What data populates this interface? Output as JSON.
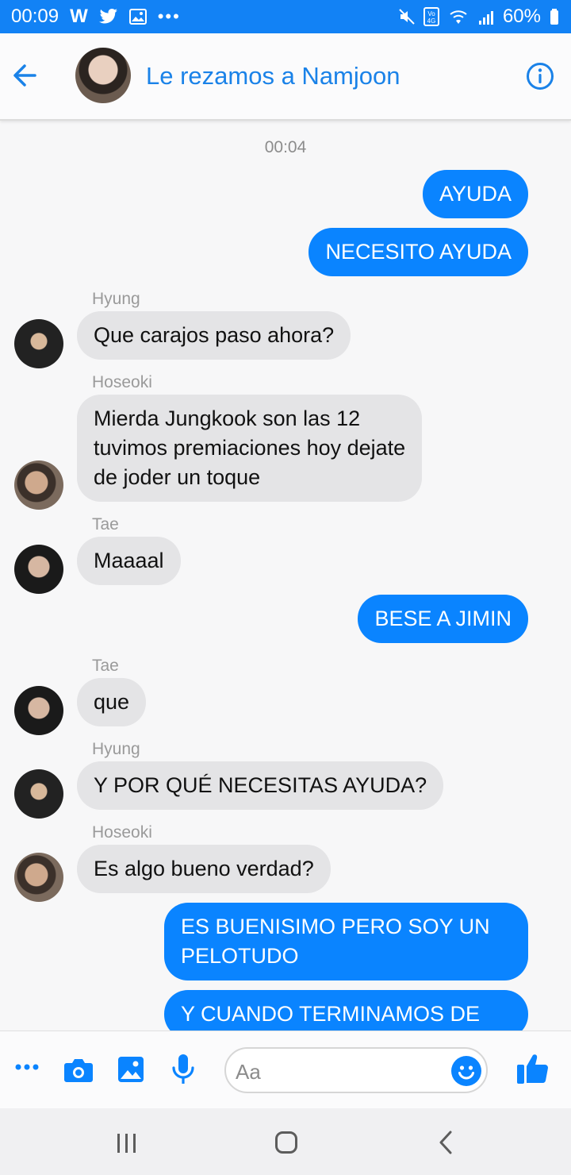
{
  "status_bar": {
    "time": "00:09",
    "battery": "60%"
  },
  "header": {
    "title": "Le rezamos a Namjoon"
  },
  "chat": {
    "timestamp": "00:04",
    "messages": [
      {
        "id": "m1",
        "type": "out",
        "text": "AYUDA"
      },
      {
        "id": "m2",
        "type": "out",
        "text": "NECESITO AYUDA"
      },
      {
        "id": "m3",
        "type": "in",
        "sender": "Hyung",
        "text": "Que carajos paso ahora?"
      },
      {
        "id": "m4",
        "type": "in",
        "sender": "Hoseoki",
        "lines": [
          "Mierda Jungkook son las 12",
          "tuvimos premiaciones hoy dejate",
          "de joder un toque"
        ]
      },
      {
        "id": "m5",
        "type": "in",
        "sender": "Tae",
        "text": "Maaaal"
      },
      {
        "id": "m6",
        "type": "out",
        "text": "BESE A JIMIN"
      },
      {
        "id": "m7",
        "type": "in",
        "sender": "Tae",
        "text": "que"
      },
      {
        "id": "m8",
        "type": "in",
        "sender": "Hyung",
        "text": "Y POR QUÉ NECESITAS AYUDA?"
      },
      {
        "id": "m9",
        "type": "in",
        "sender": "Hoseoki",
        "text": "Es algo bueno verdad?"
      },
      {
        "id": "m10",
        "type": "out",
        "lines": [
          "ES BUENISIMO PERO SOY UN",
          "PELOTUDO"
        ]
      },
      {
        "id": "m11",
        "type": "out",
        "text": "Y CUANDO TERMINAMOS DE"
      }
    ]
  },
  "composer": {
    "placeholder": "Aa"
  },
  "icons": {
    "back": "arrow-left-icon",
    "info": "info-icon",
    "more": "more-icon",
    "camera": "camera-icon",
    "gallery": "image-icon",
    "mic": "microphone-icon",
    "emoji": "emoji-icon",
    "like": "thumbs-up-icon"
  }
}
